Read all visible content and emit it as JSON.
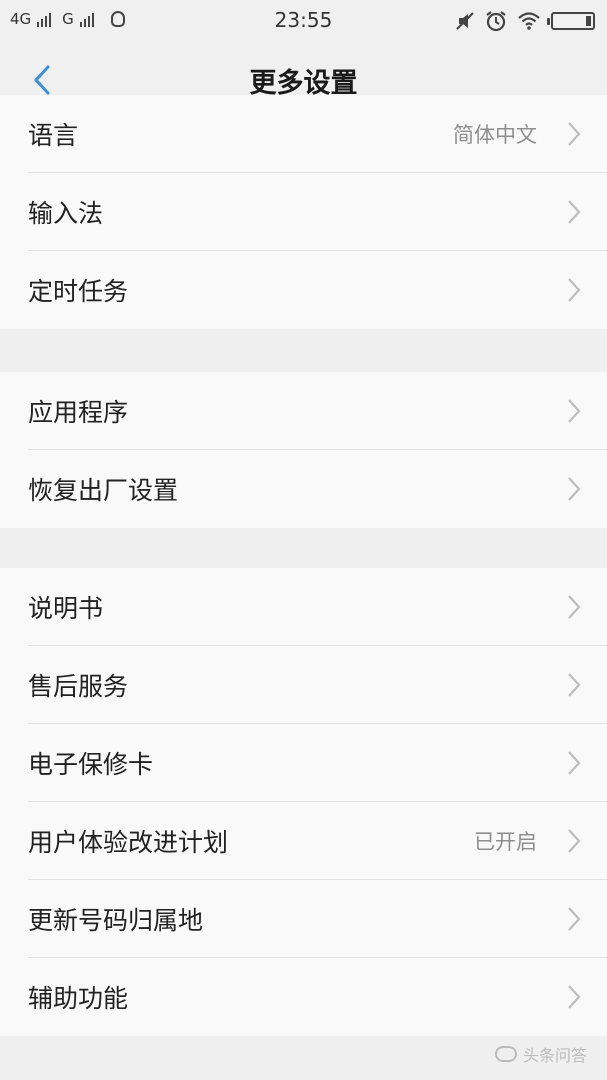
{
  "status_bar": {
    "network1": "4G",
    "network2": "G",
    "time": "23:55"
  },
  "nav": {
    "title": "更多设置",
    "back_icon": "chevron-left-icon"
  },
  "groups": [
    {
      "items": [
        {
          "label": "语言",
          "value": "简体中文"
        },
        {
          "label": "输入法"
        },
        {
          "label": "定时任务"
        }
      ]
    },
    {
      "items": [
        {
          "label": "应用程序"
        },
        {
          "label": "恢复出厂设置"
        }
      ]
    },
    {
      "items": [
        {
          "label": "说明书"
        },
        {
          "label": "售后服务"
        },
        {
          "label": "电子保修卡"
        },
        {
          "label": "用户体验改进计划",
          "value": "已开启"
        },
        {
          "label": "更新号码归属地"
        },
        {
          "label": "辅助功能"
        }
      ]
    }
  ],
  "watermark": "头条问答",
  "colors": {
    "accent": "#3d8fe0",
    "background": "#efefef",
    "row_background": "#f9f9f9"
  }
}
